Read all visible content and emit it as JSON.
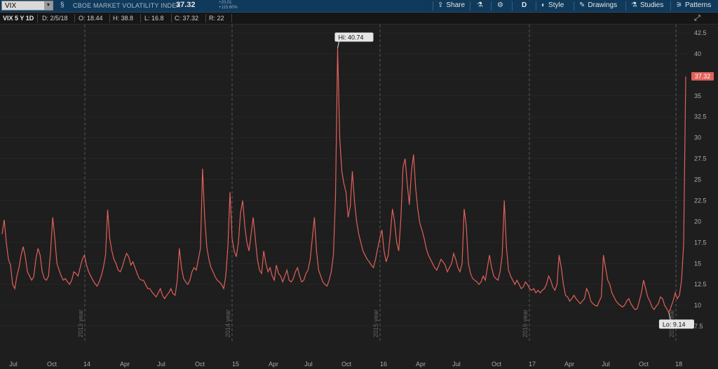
{
  "toolbar": {
    "symbol": "VIX",
    "title": "CBOE MARKET VOLATILITY INDEX",
    "last": "37.32",
    "change": "+20.01",
    "change_pct": "+115.60%",
    "share_label": "Share",
    "aggregation": "D",
    "style_label": "Style",
    "drawings_label": "Drawings",
    "studies_label": "Studies",
    "patterns_label": "Patterns"
  },
  "info": {
    "chart_label": "VIX 5 Y 1D",
    "date": "D:  2/5/18",
    "open": "O:  18.44",
    "high": "H:  38.8",
    "low": "L:  16.8",
    "close": "C:  37.32",
    "range": "R:  22"
  },
  "colors": {
    "line": "#e0605a",
    "background": "#1e1e1e",
    "grid": "#3a3a3a",
    "topbar": "#0f3a5c"
  },
  "chart_data": {
    "type": "line",
    "series": [
      {
        "name": "VIX",
        "x_start": "2013-02",
        "x_end": "2018-02",
        "values": [
          18.5,
          20.2,
          17.5,
          15.5,
          14.8,
          12.5,
          12.0,
          13.5,
          14.5,
          16.0,
          17.0,
          15.8,
          14.0,
          13.5,
          13.0,
          13.4,
          15.5,
          16.8,
          16.0,
          14.0,
          13.2,
          13.0,
          13.5,
          16.5,
          20.5,
          18.0,
          15.0,
          14.2,
          13.5,
          13.0,
          13.2,
          12.8,
          12.5,
          13.0,
          14.0,
          13.8,
          13.5,
          14.5,
          15.5,
          16.0,
          14.8,
          14.0,
          13.5,
          13.0,
          12.6,
          12.3,
          12.8,
          13.5,
          14.5,
          16.0,
          21.4,
          18.0,
          16.5,
          15.5,
          15.0,
          14.2,
          14.0,
          14.6,
          15.5,
          16.2,
          15.8,
          14.8,
          15.2,
          14.5,
          13.8,
          13.2,
          13.0,
          13.0,
          12.5,
          12.0,
          12.0,
          11.6,
          11.3,
          11.0,
          11.5,
          12.0,
          11.2,
          10.8,
          11.2,
          11.5,
          12.0,
          11.4,
          11.2,
          13.0,
          16.8,
          14.5,
          13.2,
          12.8,
          12.5,
          13.0,
          14.0,
          14.5,
          14.2,
          15.5,
          16.8,
          26.3,
          20.5,
          17.0,
          15.5,
          14.5,
          14.0,
          13.4,
          13.0,
          12.8,
          12.5,
          12.0,
          13.5,
          17.0,
          23.5,
          18.0,
          16.5,
          15.8,
          17.5,
          21.0,
          22.5,
          19.5,
          17.5,
          16.5,
          18.5,
          20.5,
          18.0,
          15.5,
          14.2,
          13.8,
          16.5,
          15.0,
          14.0,
          14.5,
          13.5,
          13.0,
          14.8,
          13.8,
          13.5,
          12.8,
          13.5,
          14.2,
          13.0,
          12.8,
          13.2,
          14.0,
          14.5,
          13.5,
          12.8,
          13.0,
          13.8,
          14.2,
          15.5,
          18.0,
          20.5,
          16.5,
          14.2,
          13.5,
          12.8,
          12.5,
          12.3,
          13.0,
          14.0,
          16.0,
          23.0,
          40.7,
          30.0,
          26.0,
          24.5,
          23.5,
          20.5,
          21.8,
          26.0,
          22.5,
          20.0,
          18.5,
          17.5,
          16.5,
          16.0,
          15.5,
          15.2,
          14.8,
          14.5,
          15.5,
          16.8,
          18.0,
          19.0,
          16.5,
          15.2,
          16.0,
          18.5,
          21.5,
          20.0,
          17.5,
          16.5,
          20.5,
          26.5,
          27.5,
          24.5,
          22.0,
          26.0,
          28.0,
          24.0,
          21.5,
          19.8,
          19.0,
          18.0,
          16.8,
          16.0,
          15.5,
          15.0,
          14.5,
          14.2,
          14.8,
          15.5,
          15.2,
          14.8,
          14.0,
          14.5,
          15.0,
          16.2,
          15.5,
          14.5,
          14.0,
          15.0,
          21.5,
          19.5,
          15.0,
          13.8,
          13.2,
          13.0,
          12.8,
          12.5,
          12.8,
          13.5,
          13.0,
          14.5,
          16.0,
          14.5,
          13.5,
          13.2,
          13.0,
          14.0,
          16.0,
          22.5,
          17.0,
          14.2,
          13.5,
          13.0,
          12.5,
          13.0,
          12.5,
          12.0,
          12.2,
          12.8,
          12.5,
          12.0,
          11.8,
          12.0,
          11.5,
          11.8,
          11.5,
          11.8,
          12.0,
          12.5,
          13.5,
          13.0,
          12.2,
          11.8,
          12.5,
          16.0,
          14.5,
          12.5,
          11.2,
          11.0,
          10.5,
          10.8,
          11.2,
          10.8,
          10.5,
          10.2,
          10.5,
          10.8,
          12.0,
          11.5,
          10.5,
          10.2,
          10.0,
          9.9,
          10.5,
          11.0,
          16.0,
          14.5,
          13.0,
          12.5,
          11.5,
          11.0,
          10.5,
          10.2,
          10.0,
          9.8,
          10.0,
          10.5,
          10.8,
          10.2,
          9.8,
          9.5,
          9.6,
          10.5,
          11.5,
          13.0,
          12.0,
          11.0,
          10.5,
          9.8,
          9.5,
          9.9,
          10.2,
          11.0,
          10.8,
          10.0,
          9.6,
          9.14,
          9.8,
          10.5,
          11.5,
          10.8,
          11.2,
          13.0,
          17.3,
          37.3
        ]
      }
    ],
    "x_tick_labels": [
      "Jul",
      "Oct",
      "14",
      "Apr",
      "Jul",
      "Oct",
      "15",
      "Apr",
      "Jul",
      "Oct",
      "16",
      "Apr",
      "Jul",
      "Oct",
      "17",
      "Apr",
      "Jul",
      "Oct",
      "18"
    ],
    "y_tick_labels": [
      "7.5",
      "10",
      "12.5",
      "15",
      "17.5",
      "20",
      "22.5",
      "25",
      "27.5",
      "30",
      "32.5",
      "35",
      "37.5",
      "40",
      "42.5"
    ],
    "ylim": [
      5.5,
      43.5
    ],
    "year_markers": [
      "2013 year",
      "2014 year",
      "2015 year",
      "2016 year",
      "2017 year"
    ],
    "annotations": {
      "hi": "Hi: 40.74",
      "lo": "Lo: 9.14",
      "last_tag": "37.32"
    }
  }
}
